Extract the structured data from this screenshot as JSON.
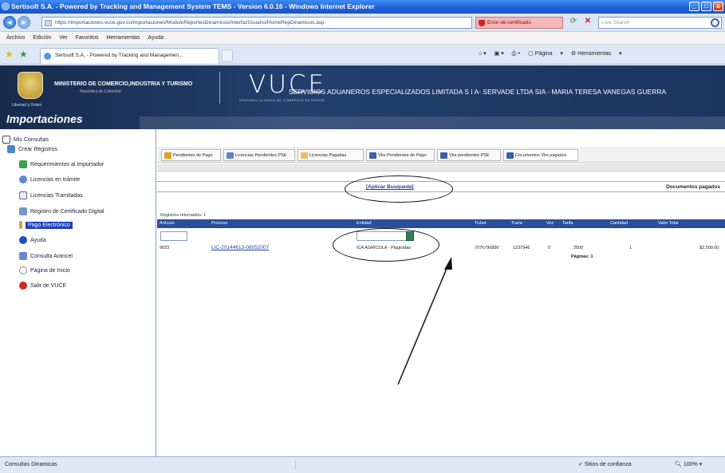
{
  "window": {
    "title": "Sertisoft S.A. - Powered by Tracking and Management System TEMS - Version 6.0.16 - Windows Internet Explorer",
    "minimize": "_",
    "maximize": "□",
    "close": "x"
  },
  "address_bar": {
    "url": "https://importaciones.vuce.gov.co/importaciones/ModuloReportesDinamicos/InterfazUsuario/HomeRepDinamicos.asp",
    "certificate_error": "Error de certificado",
    "search_placeholder": "Live Search"
  },
  "menu": [
    "Archivo",
    "Edición",
    "Ver",
    "Favoritos",
    "Herramientas",
    "Ayuda"
  ],
  "tabs": {
    "active_title": "Sertisoft S.A. - Powered by Tracking and Managemen..."
  },
  "toolbar": {
    "pagina": "Página",
    "herramientas": "Herramientas"
  },
  "header": {
    "ministry": "MINISTERIO DE COMERCIO,INDUSTRIA Y TURISMO",
    "ministry_sub": "República de Colombia",
    "logo_caption": "Libertad y Orden",
    "vuce": "VUCE",
    "vuce_sub": "VENTANILLA ÚNICA DE COMERCIO EXTERIOR",
    "company": "SERVICIOS ADUANEROS ESPECIALIZADOS LIMITADA S I A- SERVADE LTDA SIA - MARIA TERESA VANEGAS GUERRA",
    "section": "Importaciones"
  },
  "sidebar": {
    "items": [
      {
        "label": "Mis Consultas"
      },
      {
        "label": "Crear Registros"
      },
      {
        "label": "Requerimientos al Importador"
      },
      {
        "label": "Licencias en trámite"
      },
      {
        "label": "Licencias Tramitadas"
      },
      {
        "label": "Registro de Certificado Digital"
      },
      {
        "label": "Pago Electrónico"
      },
      {
        "label": "Ayuda"
      },
      {
        "label": "Consulta Arancel"
      },
      {
        "label": "Página de Inicio"
      },
      {
        "label": "Salir de VUCE"
      }
    ]
  },
  "content_tabs": [
    {
      "label": "Pendientes de Pago"
    },
    {
      "label": "Licencias Pendientes PSE"
    },
    {
      "label": "Licencias Pagadas"
    },
    {
      "label": "Vbs Pendientes de Pago"
    },
    {
      "label": "Vbs pendientes PSE"
    },
    {
      "label": "Documentos Vbs pagados"
    }
  ],
  "search": {
    "apply": "[Aplicar Busqueda]",
    "section_label": "Documentos pagados"
  },
  "results": {
    "count_text": "Registros retornados: 1",
    "columns": [
      "Artículo",
      "Proceso",
      "Entidad",
      "Ticket",
      "Traza",
      "Vez",
      "Tarifa",
      "Cantidad",
      "Valor Total"
    ],
    "row": {
      "articulo": "9023",
      "proceso": "LIC-20144613-08052007",
      "entidad": "ICA AGRICOLA - Plagicidas",
      "ticket": "7076796890",
      "traza": "1237946",
      "vez": "0",
      "tarifa": "2500",
      "cantidad": "1",
      "valor_total": "$2,500.00"
    },
    "pages": "Páginas: 1"
  },
  "status_bar": {
    "text": "Consultas Dinamicas",
    "zone": "Sitios de confianza",
    "zoom": "100%"
  }
}
